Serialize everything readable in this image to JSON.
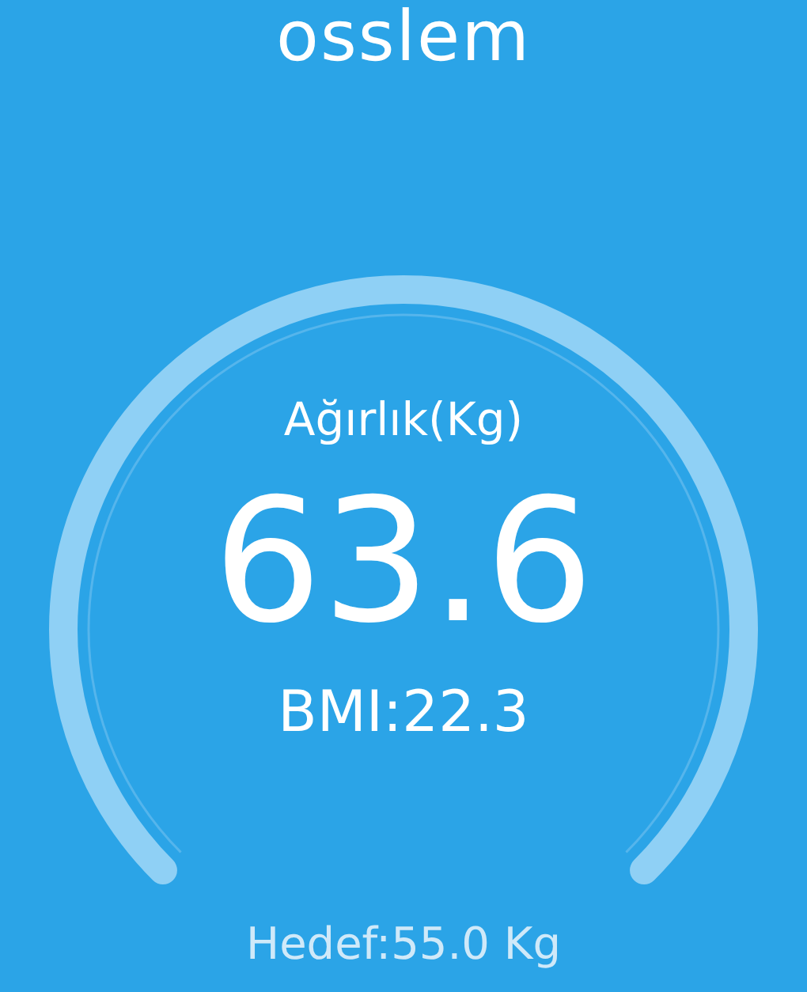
{
  "header": {
    "title": "osslem"
  },
  "gauge": {
    "label": "Ağırlık(Kg)",
    "value": "63.6",
    "bmi": "BMI:22.3",
    "target": "Hedef:55.0 Kg"
  }
}
